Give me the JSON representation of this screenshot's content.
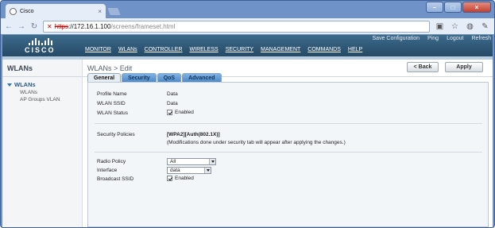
{
  "browser": {
    "tab_title": "Cisco",
    "tab_close": "×",
    "window_controls": [
      "–",
      "□",
      "×"
    ],
    "url_scheme": "https",
    "url_host": "://172.16.1.100",
    "url_path": "/screens/frameset.html",
    "insecure_mark": "✕"
  },
  "header": {
    "logo_text": "CISCO",
    "util_links": [
      "Save Configuration",
      "Ping",
      "Logout",
      "Refresh"
    ],
    "menu": [
      "MONITOR",
      "WLANs",
      "CONTROLLER",
      "WIRELESS",
      "SECURITY",
      "MANAGEMENT",
      "COMMANDS",
      "HELP"
    ]
  },
  "sidebar": {
    "title": "WLANs",
    "group": "WLANs",
    "items": [
      "WLANs",
      "AP Groups VLAN"
    ]
  },
  "main": {
    "title": "WLANs > Edit",
    "back_label": "< Back",
    "apply_label": "Apply",
    "tabs": [
      "General",
      "Security",
      "QoS",
      "Advanced"
    ],
    "active_tab": "General",
    "fields": {
      "profile_name_label": "Profile Name",
      "profile_name_value": "Data",
      "wlan_ssid_label": "WLAN SSID",
      "wlan_ssid_value": "Data",
      "wlan_status_label": "WLAN Status",
      "wlan_status_value": "Enabled",
      "security_policies_label": "Security Policies",
      "security_policies_value": "[WPA2][Auth(802.1X)]",
      "security_note": "(Modifications done under security tab will appear after applying the changes.)",
      "radio_policy_label": "Radio Policy",
      "radio_policy_value": "All",
      "interface_label": "Interface",
      "interface_value": "data",
      "broadcast_ssid_label": "Broadcast SSID",
      "broadcast_ssid_value": "Enabled"
    }
  }
}
